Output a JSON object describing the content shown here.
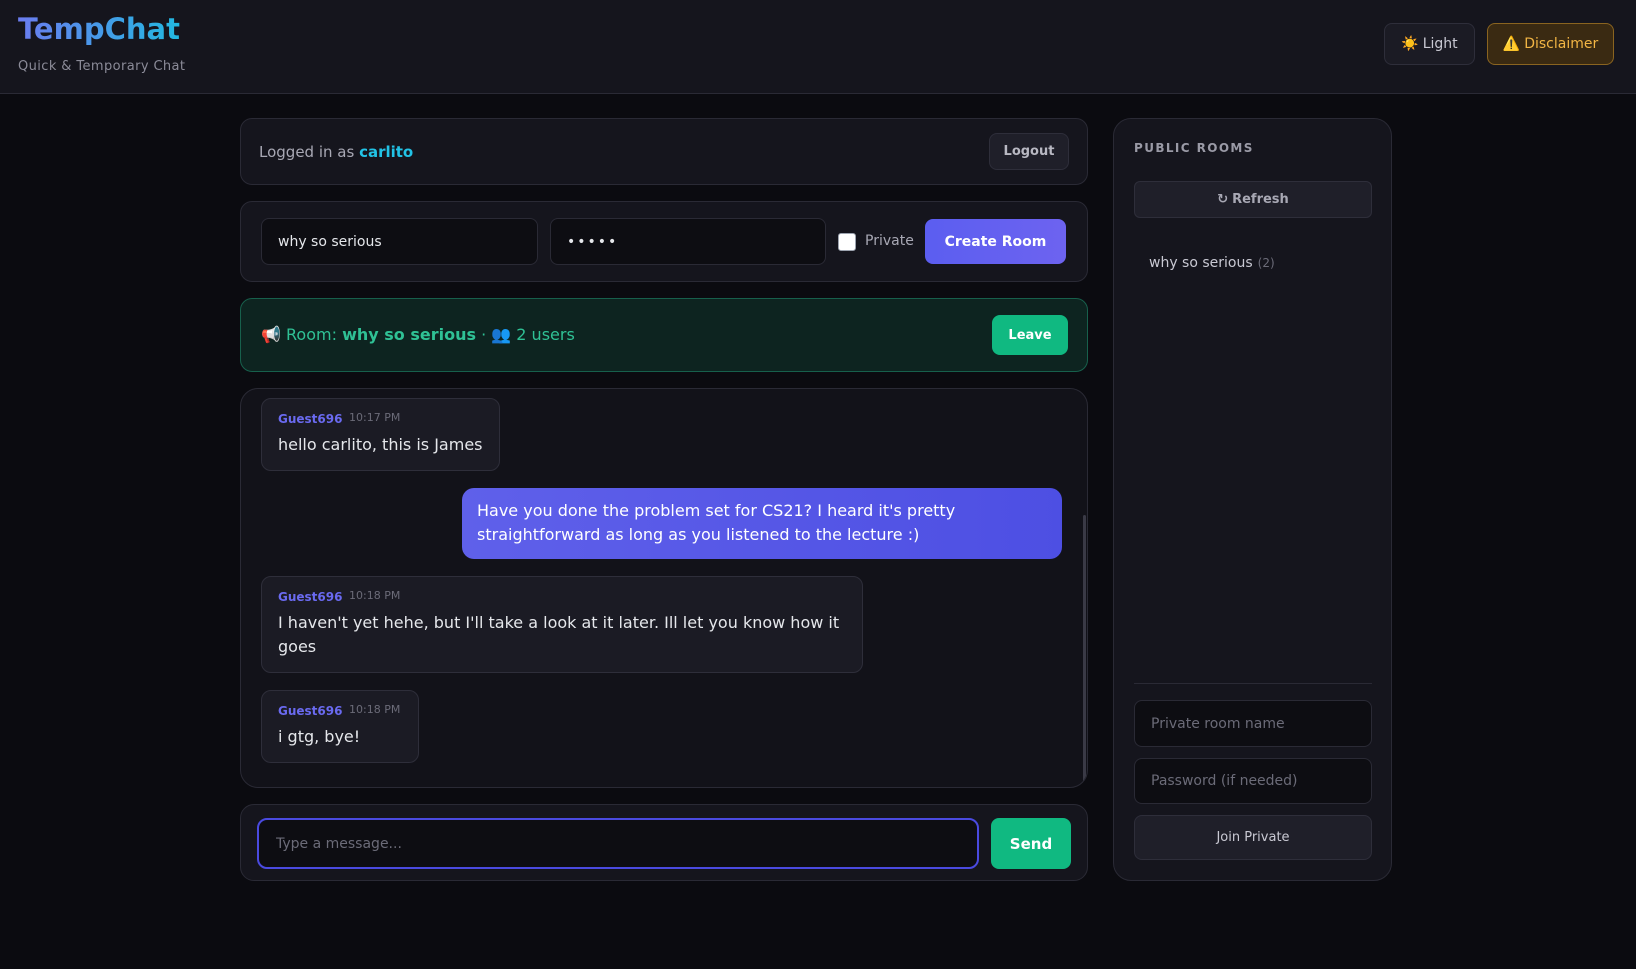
{
  "header": {
    "title": "TempChat",
    "subtitle": "Quick & Temporary Chat",
    "theme_icon": "sun-icon",
    "theme_icon_glyph": "☀️",
    "theme_label": "Light",
    "disclaimer_icon": "warning-icon",
    "disclaimer_icon_glyph": "⚠️",
    "disclaimer_label": "Disclaimer"
  },
  "session": {
    "prefix": "Logged in as",
    "username": "carlito",
    "logout_label": "Logout"
  },
  "create_room": {
    "name_value": "why so serious",
    "password_value": "•••••",
    "private_label": "Private",
    "private_checked": false,
    "button_label": "Create Room"
  },
  "room": {
    "icon": "megaphone-icon",
    "icon_glyph": "📢",
    "prefix": "Room:",
    "name": "why so serious",
    "separator": "·",
    "users_icon": "users-icon",
    "users_icon_glyph": "👥",
    "users_text": "2 users",
    "leave_label": "Leave"
  },
  "messages": [
    {
      "author": "Guest696",
      "time": "10:17 PM",
      "text": "hello carlito, this is James",
      "own": false
    },
    {
      "author": "",
      "time": "",
      "text": "Have you done the problem set for CS21? I heard it's pretty straightforward as long as you listened to the lecture :)",
      "own": true
    },
    {
      "author": "Guest696",
      "time": "10:18 PM",
      "text": "I haven't yet hehe, but I'll take a look at it later. Ill let you know how it goes",
      "own": false
    },
    {
      "author": "Guest696",
      "time": "10:18 PM",
      "text": "i gtg, bye!",
      "own": false
    }
  ],
  "composer": {
    "placeholder": "Type a message...",
    "value": "",
    "send_label": "Send"
  },
  "sidebar": {
    "title": "PUBLIC ROOMS",
    "refresh_icon": "refresh-icon",
    "refresh_icon_glyph": "↻",
    "refresh_label": "Refresh",
    "rooms": [
      {
        "name": "why so serious",
        "count": "(2)"
      }
    ],
    "private_name_placeholder": "Private room name",
    "private_password_placeholder": "Password (if needed)",
    "join_label": "Join Private"
  },
  "colors": {
    "background": "#0b0b10",
    "panel": "#15151d",
    "accent_indigo": "#5b5ef0",
    "accent_green": "#10b981",
    "username_cyan": "#22c3e6",
    "warning_amber": "#f2b544"
  }
}
